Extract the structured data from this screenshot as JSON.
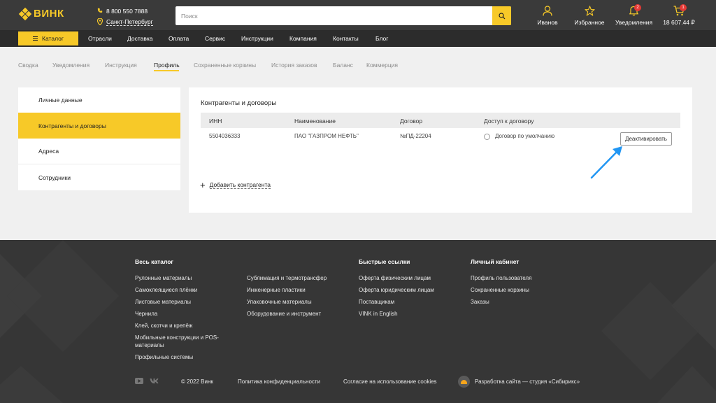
{
  "header": {
    "logo_text": "ВИНК",
    "phone": "8 800 550 7888",
    "city": "Санкт-Петербург",
    "search_placeholder": "Поиск",
    "user_label": "Иванов",
    "favorites_label": "Избранное",
    "notifications_label": "Уведомления",
    "notifications_count": "2",
    "cart_label": "18 607.44 ₽",
    "cart_count": "1"
  },
  "nav": {
    "catalog_label": "Каталог",
    "links": [
      "Отрасли",
      "Доставка",
      "Оплата",
      "Сервис",
      "Инструкции",
      "Компания",
      "Контакты",
      "Блог"
    ]
  },
  "tabs": [
    "Сводка",
    "Уведомления",
    "Инструкция",
    "Профиль",
    "Сохраненные корзины",
    "История заказов",
    "Баланс",
    "Коммерция"
  ],
  "sidebar": {
    "items": [
      "Личные данные",
      "Контрагенты и договоры",
      "Адреса",
      "Сотрудники"
    ]
  },
  "content": {
    "title": "Контрагенты и договоры",
    "columns": [
      "ИНН",
      "Наименование",
      "Договор",
      "Доступ к договору"
    ],
    "row": {
      "inn": "5504036333",
      "name": "ПАО \"ГАЗПРОМ НЕФТЬ\"",
      "contract": "№ПД-22204",
      "access": "Договор по умолчанию"
    },
    "deactivate_label": "Деактивировать",
    "add_label": "Добавить контрагента"
  },
  "footer": {
    "col1_title": "Весь каталог",
    "col1_links": [
      "Рулонные материалы",
      "Самоклеящиеся плёнки",
      "Листовые материалы",
      "Чернила",
      "Клей, скотчи и крепёж",
      "Мобильные конструкции и POS-материалы",
      "Профильные системы"
    ],
    "col2_links": [
      "Сублимация и термотрансфер",
      "Инженерные пластики",
      "Упаковочные материалы",
      "Оборудование и инструмент"
    ],
    "col3_title": "Быстрые ссылки",
    "col3_links": [
      "Оферта физическим лицам",
      "Оферта юридическим лицам",
      "Поставщикам",
      "VINK in English"
    ],
    "col4_title": "Личный кабинет",
    "col4_links": [
      "Профиль пользователя",
      "Сохраненные корзины",
      "Заказы"
    ],
    "copyright": "© 2022 Винк",
    "privacy": "Политика конфиденциальности",
    "cookies": "Согласие на использование cookies",
    "developer": "Разработка сайта — студия «Сибирикс»"
  },
  "colors": {
    "accent": "#f7c928",
    "header_bg": "#3a3a3a",
    "nav_bg": "#2c2c2c",
    "footer_bg": "#363636",
    "arrow": "#2196f3"
  }
}
